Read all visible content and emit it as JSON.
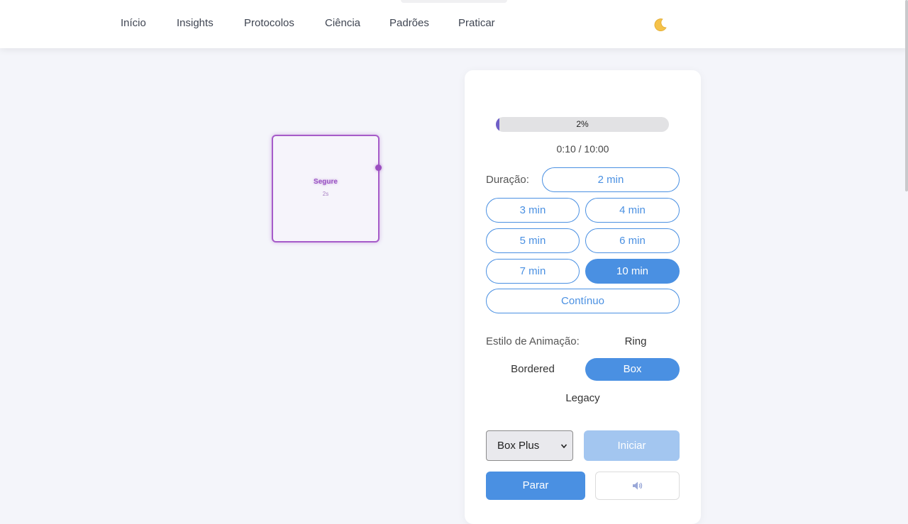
{
  "nav": {
    "items": [
      "Início",
      "Insights",
      "Protocolos",
      "Ciência",
      "Padrões",
      "Praticar"
    ],
    "theme_icon": "moon-icon"
  },
  "breath": {
    "phase": "Segure",
    "seconds": "2s"
  },
  "progress": {
    "percent_label": "2%",
    "fraction": 0.02,
    "time": "0:10 / 10:00"
  },
  "duration": {
    "label": "Duração:",
    "options": [
      "2 min",
      "3 min",
      "4 min",
      "5 min",
      "6 min",
      "7 min",
      "10 min",
      "Contínuo"
    ],
    "selected": "10 min"
  },
  "animation": {
    "label": "Estilo de Animação:",
    "options": [
      "Ring",
      "Bordered",
      "Box",
      "Legacy"
    ],
    "selected": "Box"
  },
  "controls": {
    "pattern_select": "Box Plus",
    "start_label": "Iniciar",
    "stop_label": "Parar",
    "sound_icon": "speaker-icon"
  },
  "colors": {
    "accent": "#4a90e2",
    "breath": "#a65bc9",
    "progress": "#6f5fc7"
  }
}
